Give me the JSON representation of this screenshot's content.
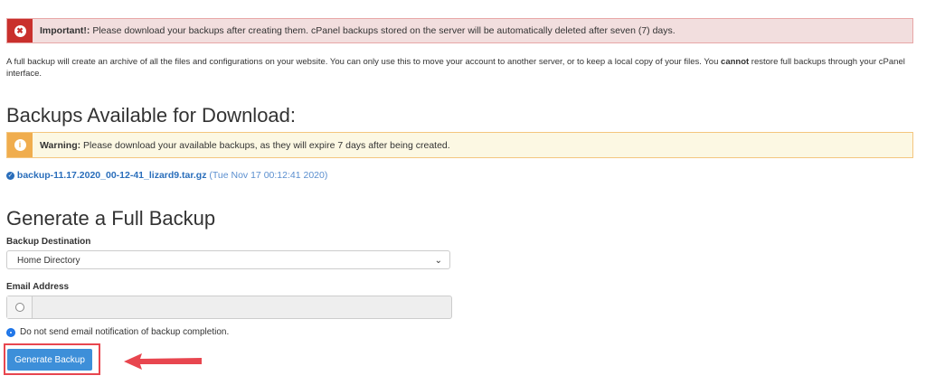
{
  "important": {
    "label": "Important!:",
    "text": " Please download your backups after creating them. cPanel backups stored on the server will be automatically deleted after seven (7) days."
  },
  "intro": {
    "text1": "A full backup will create an archive of all the files and configurations on your website. You can only use this to move your account to another server, or to keep a local copy of your files. You ",
    "bold": "cannot",
    "text2": " restore full backups through your cPanel interface."
  },
  "available": {
    "heading": "Backups Available for Download:",
    "warning_label": "Warning:",
    "warning_text": " Please download your available backups, as they will expire 7 days after being created.",
    "files": [
      {
        "name": "backup-11.17.2020_00-12-41_lizard9.tar.gz",
        "date": "(Tue Nov 17 00:12:41 2020)"
      }
    ]
  },
  "generate": {
    "heading": "Generate a Full Backup",
    "dest_label": "Backup Destination",
    "dest_value": "Home Directory",
    "email_label": "Email Address",
    "email_value": "",
    "no_email_label": "Do not send email notification of backup completion.",
    "button": "Generate Backup"
  },
  "colors": {
    "accent": "#3d8fd9",
    "danger": "#c9302c",
    "warning": "#f0ad4e",
    "highlight": "#e8464f"
  }
}
